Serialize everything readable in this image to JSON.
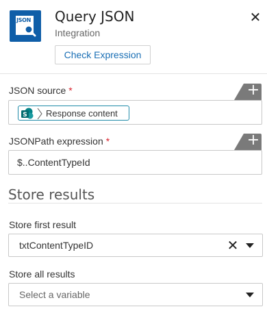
{
  "header": {
    "icon_text": "JSON",
    "title": "Query JSON",
    "subtitle": "Integration",
    "check_button": "Check Expression",
    "close_symbol": "✕"
  },
  "fields": {
    "json_source": {
      "label": "JSON source",
      "required_mark": "*",
      "token_label": "Response content",
      "token_icon": "sharepoint-icon",
      "add_symbol": "+"
    },
    "jsonpath": {
      "label": "JSONPath expression",
      "required_mark": "*",
      "value": "$..ContentTypeId",
      "add_symbol": "+"
    }
  },
  "store_results": {
    "title": "Store results",
    "first": {
      "label": "Store first result",
      "value": "txtContentTypeID",
      "clear_symbol": "✕"
    },
    "all": {
      "label": "Store all results",
      "placeholder": "Select a variable"
    }
  },
  "colors": {
    "brand_blue": "#0f5ea8",
    "link_blue": "#1a6fb5",
    "required_red": "#d9232e",
    "token_border": "#1f8aa8",
    "sharepoint_teal": "#038387"
  }
}
